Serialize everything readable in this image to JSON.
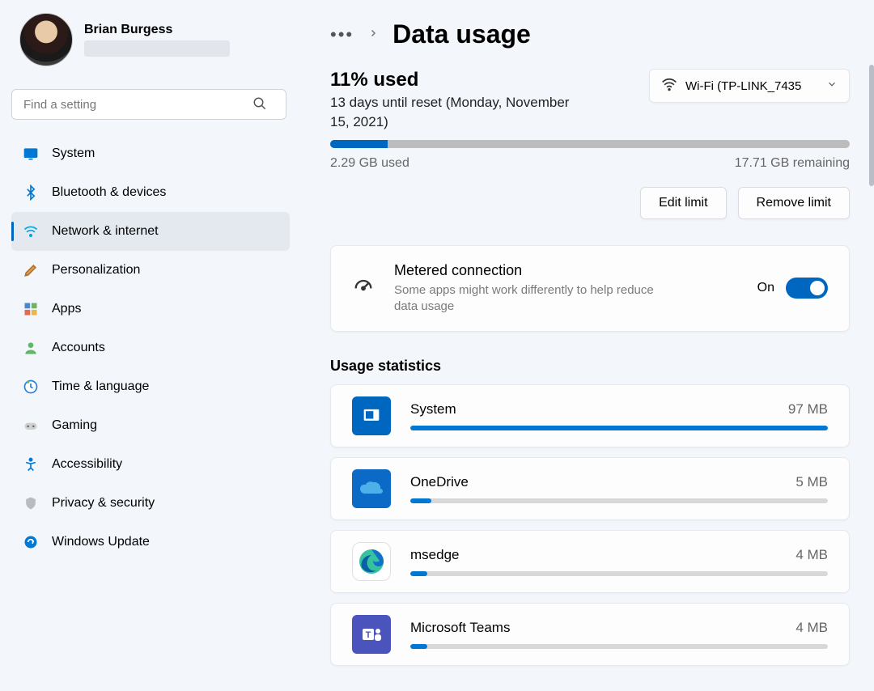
{
  "profile": {
    "name": "Brian Burgess"
  },
  "search": {
    "placeholder": "Find a setting"
  },
  "sidebar": {
    "items": [
      {
        "label": "System",
        "icon": "system",
        "selected": false
      },
      {
        "label": "Bluetooth & devices",
        "icon": "bluetooth",
        "selected": false
      },
      {
        "label": "Network & internet",
        "icon": "wifi",
        "selected": true
      },
      {
        "label": "Personalization",
        "icon": "paint",
        "selected": false
      },
      {
        "label": "Apps",
        "icon": "apps",
        "selected": false
      },
      {
        "label": "Accounts",
        "icon": "account",
        "selected": false
      },
      {
        "label": "Time & language",
        "icon": "time",
        "selected": false
      },
      {
        "label": "Gaming",
        "icon": "gaming",
        "selected": false
      },
      {
        "label": "Accessibility",
        "icon": "accessibility",
        "selected": false
      },
      {
        "label": "Privacy & security",
        "icon": "privacy",
        "selected": false
      },
      {
        "label": "Windows Update",
        "icon": "update",
        "selected": false
      }
    ]
  },
  "header": {
    "title": "Data usage",
    "usagePercent": "11% used",
    "resetText": "13 days until reset (Monday, November 15, 2021)",
    "networkLabel": "Wi-Fi (TP-LINK_7435",
    "progressPercent": 11,
    "used": "2.29 GB used",
    "remaining": "17.71 GB remaining",
    "editLimit": "Edit limit",
    "removeLimit": "Remove limit"
  },
  "metered": {
    "icon": "speedometer",
    "title": "Metered connection",
    "desc": "Some apps might work differently to help reduce data usage",
    "state": "On",
    "on": true
  },
  "statsTitle": "Usage statistics",
  "stats": [
    {
      "name": "System",
      "value": "97 MB",
      "percent": 100,
      "icon": "system-app",
      "color": "#0067c0"
    },
    {
      "name": "OneDrive",
      "value": "5 MB",
      "percent": 5,
      "icon": "onedrive",
      "color": "#0a6ac6"
    },
    {
      "name": "msedge",
      "value": "4 MB",
      "percent": 4,
      "icon": "edge",
      "color": "#1b9e77"
    },
    {
      "name": "Microsoft Teams",
      "value": "4 MB",
      "percent": 4,
      "icon": "teams",
      "color": "#4b53bc"
    }
  ],
  "colors": {
    "accent": "#0067c0",
    "accentLight": "#0078d4"
  }
}
